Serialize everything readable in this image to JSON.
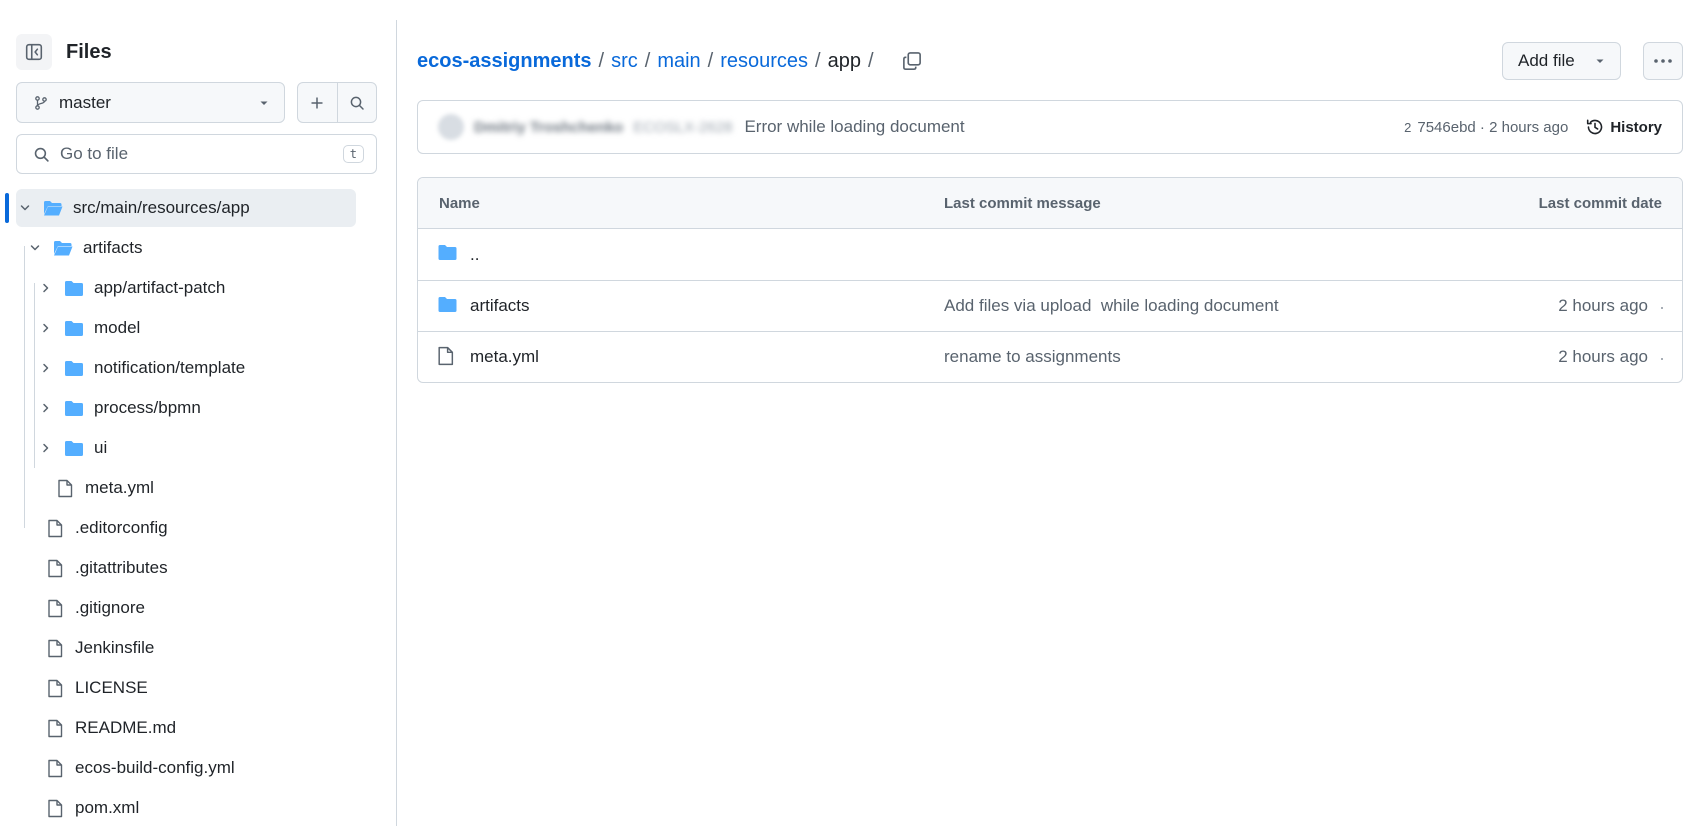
{
  "sidebar": {
    "title": "Files",
    "branch": "master",
    "goto_placeholder": "Go to file",
    "goto_shortcut": "t",
    "tree": [
      {
        "label": "src/main/resources/app",
        "type": "folder-open",
        "expanded": true,
        "selected": true
      },
      {
        "label": "artifacts",
        "type": "folder-open",
        "expanded": true
      },
      {
        "label": "app/artifact-patch",
        "type": "folder"
      },
      {
        "label": "model",
        "type": "folder"
      },
      {
        "label": "notification/template",
        "type": "folder"
      },
      {
        "label": "process/bpmn",
        "type": "folder"
      },
      {
        "label": "ui",
        "type": "folder"
      },
      {
        "label": "meta.yml",
        "type": "file"
      },
      {
        "label": ".editorconfig",
        "type": "file"
      },
      {
        "label": ".gitattributes",
        "type": "file"
      },
      {
        "label": ".gitignore",
        "type": "file"
      },
      {
        "label": "Jenkinsfile",
        "type": "file"
      },
      {
        "label": "LICENSE",
        "type": "file"
      },
      {
        "label": "README.md",
        "type": "file"
      },
      {
        "label": "ecos-build-config.yml",
        "type": "file"
      },
      {
        "label": "pom.xml",
        "type": "file"
      }
    ]
  },
  "breadcrumb": {
    "repo": "ecos-assignments",
    "parts": [
      "src",
      "main",
      "resources"
    ],
    "current": "app",
    "separator": "/"
  },
  "toolbar": {
    "add_file": "Add file"
  },
  "commit": {
    "author": "Dmitriy Troshchenko",
    "message_blurred": "ECOSLX-2628",
    "error": "Error while loading document",
    "checks": "2",
    "meta": "7546ebd · 2 hours ago",
    "history": "History"
  },
  "table": {
    "headers": [
      "Name",
      "Last commit message",
      "Last commit date"
    ],
    "parent_label": "..",
    "rows": [
      {
        "name": "artifacts",
        "type": "folder",
        "message": "Add files via upload  while loading document",
        "date": "2 hours ago"
      },
      {
        "name": "meta.yml",
        "type": "file",
        "message": "rename to assignments",
        "date": "2 hours ago"
      }
    ]
  },
  "colors": {
    "accent": "#0969da",
    "folder": "#54aeff",
    "border": "#d0d7de",
    "muted": "#59636e"
  }
}
